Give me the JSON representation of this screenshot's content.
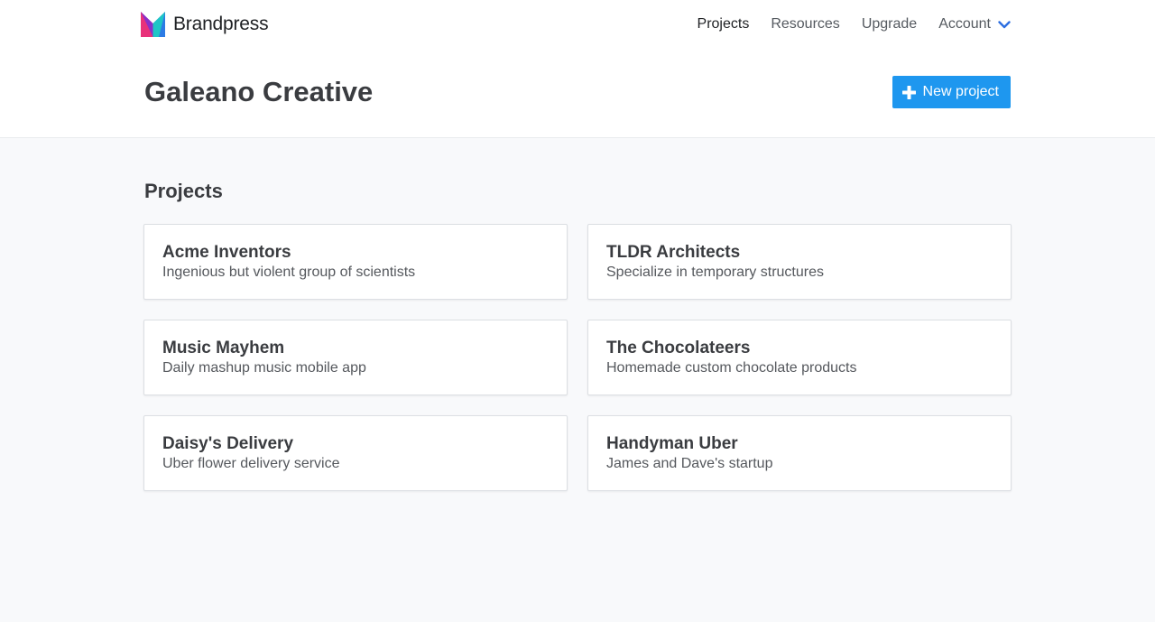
{
  "brand": {
    "name": "Brandpress",
    "logo_icon": "brandpress-logo-icon",
    "logo_colors": [
      "#e8317a",
      "#2c7be5",
      "#1ec6c6",
      "#3b3fd1"
    ]
  },
  "nav": {
    "items": [
      {
        "label": "Projects",
        "active": true
      },
      {
        "label": "Resources"
      },
      {
        "label": "Upgrade"
      }
    ],
    "account": {
      "label": "Account",
      "icon": "chevron-down-icon"
    }
  },
  "header": {
    "title": "Galeano Creative",
    "new_project_label": "New project",
    "new_project_icon": "plus-icon"
  },
  "colors": {
    "accent": "#1e97ef",
    "background": "#f8f9fb",
    "chevron": "#2c6ee0"
  },
  "projects": {
    "title": "Projects",
    "items": [
      {
        "name": "Acme Inventors",
        "description": "Ingenious but violent group of scientists"
      },
      {
        "name": "TLDR Architects",
        "description": "Specialize in temporary structures"
      },
      {
        "name": "Music Mayhem",
        "description": "Daily mashup music mobile app"
      },
      {
        "name": "The Chocolateers",
        "description": "Homemade custom chocolate products"
      },
      {
        "name": "Daisy's Delivery",
        "description": "Uber flower delivery service"
      },
      {
        "name": "Handyman Uber",
        "description": "James and Dave's startup"
      }
    ]
  }
}
